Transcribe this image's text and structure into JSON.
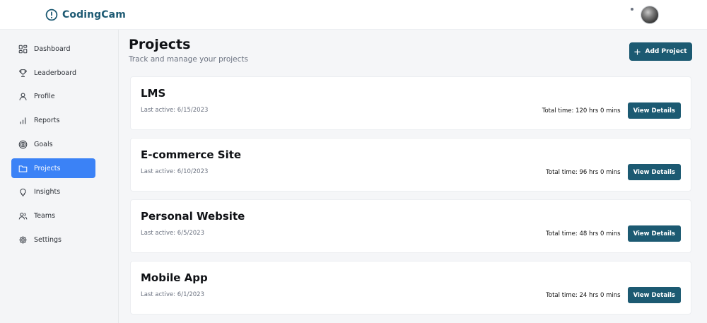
{
  "brand": {
    "name": "CodingCam",
    "icon": "info-circle-icon",
    "color": "#1d5a73"
  },
  "sidebar": {
    "items": [
      {
        "label": "Dashboard",
        "icon": "dashboard-icon",
        "active": false
      },
      {
        "label": "Leaderboard",
        "icon": "trophy-icon",
        "active": false
      },
      {
        "label": "Profile",
        "icon": "user-icon",
        "active": false
      },
      {
        "label": "Reports",
        "icon": "bar-chart-icon",
        "active": false
      },
      {
        "label": "Goals",
        "icon": "target-icon",
        "active": false
      },
      {
        "label": "Projects",
        "icon": "folder-icon",
        "active": true
      },
      {
        "label": "Insights",
        "icon": "lightbulb-icon",
        "active": false
      },
      {
        "label": "Teams",
        "icon": "users-icon",
        "active": false
      },
      {
        "label": "Settings",
        "icon": "gear-icon",
        "active": false
      }
    ],
    "active_color": "#3b82f6"
  },
  "main": {
    "title": "Projects",
    "subtitle": "Track and manage your projects",
    "add_button_label": "Add Project",
    "projects": [
      {
        "name": "LMS",
        "last_active": "Last active: 6/15/2023",
        "total_time": "Total time: 120 hrs 0 mins",
        "button_label": "View Details"
      },
      {
        "name": "E-commerce Site",
        "last_active": "Last active: 6/10/2023",
        "total_time": "Total time: 96 hrs 0 mins",
        "button_label": "View Details"
      },
      {
        "name": "Personal Website",
        "last_active": "Last active: 6/5/2023",
        "total_time": "Total time: 48 hrs 0 mins",
        "button_label": "View Details"
      },
      {
        "name": "Mobile App",
        "last_active": "Last active: 6/1/2023",
        "total_time": "Total time: 24 hrs 0 mins",
        "button_label": "View Details"
      }
    ]
  },
  "colors": {
    "primary_button": "#1c5a72"
  }
}
